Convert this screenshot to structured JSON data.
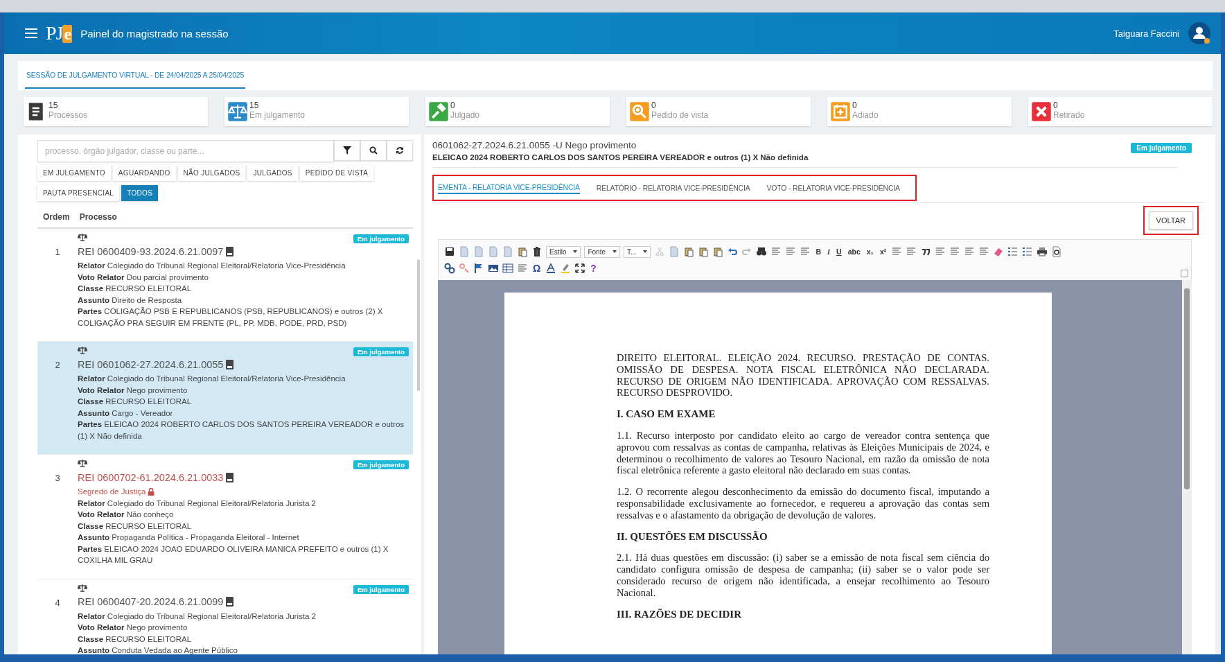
{
  "header": {
    "logo_main": "PJ",
    "logo_accent": "e",
    "title": "Painel do magistrado na sessão",
    "user": "Taiguara Faccini"
  },
  "session_tab": {
    "label": "SESSÃO DE JULGAMENTO VIRTUAL - DE 24/04/2025 A 25/04/2025",
    "selected": true
  },
  "stats": [
    {
      "count": "15",
      "label": "Processos",
      "color": "#3a3a3a"
    },
    {
      "count": "15",
      "label": "Em julgamento",
      "color": "#2e8bc9"
    },
    {
      "count": "0",
      "label": "Julgado",
      "color": "#3aa845"
    },
    {
      "count": "0",
      "label": "Pedido de vista",
      "color": "#f39c1f"
    },
    {
      "count": "0",
      "label": "Adiado",
      "color": "#f39c1f"
    },
    {
      "count": "0",
      "label": "Retirado",
      "color": "#e8303a"
    }
  ],
  "search": {
    "placeholder": "processo, órgão julgador, classe ou parte..."
  },
  "filters": [
    {
      "label": "EM JULGAMENTO",
      "selected": false
    },
    {
      "label": "AGUARDANDO",
      "selected": false
    },
    {
      "label": "NÃO JULGADOS",
      "selected": false
    },
    {
      "label": "JULGADOS",
      "selected": false
    },
    {
      "label": "PEDIDO DE VISTA",
      "selected": false
    },
    {
      "label": "PAUTA PRESENCIAL",
      "selected": false
    },
    {
      "label": "TODOS",
      "selected": true
    }
  ],
  "list_columns": [
    "Ordem",
    "Processo"
  ],
  "processes": [
    {
      "order": "1",
      "number": "REI 0600409-93.2024.6.21.0097",
      "badge": "Em julgamento",
      "selected": false,
      "secret": false,
      "fields": [
        "**Relator** Colegiado do Tribunal Regional Eleitoral/Relatoria Vice-Presidência",
        "**Voto Relator** Dou parcial provimento",
        "**Classe** RECURSO ELEITORAL",
        "**Assunto** Direito de Resposta",
        "**Partes** COLIGAÇÃO PSB E REPUBLICANOS (PSB, REPUBLICANOS) e outros (2) X COLIGAÇÃO PRA SEGUIR EM FRENTE (PL, PP, MDB, PODE, PRD, PSD)"
      ]
    },
    {
      "order": "2",
      "number": "REI 0601062-27.2024.6.21.0055",
      "badge": "Em julgamento",
      "selected": true,
      "secret": false,
      "fields": [
        "**Relator** Colegiado do Tribunal Regional Eleitoral/Relatoria Vice-Presidência",
        "**Voto Relator** Nego provimento",
        "**Classe** RECURSO ELEITORAL",
        "**Assunto** Cargo - Vereador",
        "**Partes** ELEICAO 2024 ROBERTO CARLOS DOS SANTOS PEREIRA VEREADOR e outros (1) X Não definida"
      ]
    },
    {
      "order": "3",
      "number": "REI 0600702-61.2024.6.21.0033",
      "badge": "Em julgamento",
      "selected": false,
      "secret": true,
      "secret_label": "Segredo de Justiça",
      "fields": [
        "**Relator** Colegiado do Tribunal Regional Eleitoral/Relatoria Jurista 2",
        "**Voto Relator** Não conheço",
        "**Classe** RECURSO ELEITORAL",
        "**Assunto** Propaganda Política - Propaganda Eleitoral - Internet",
        "**Partes** ELEICAO 2024 JOAO EDUARDO OLIVEIRA MANICA PREFEITO e outros (1) X COXILHA MIL GRAU"
      ]
    },
    {
      "order": "4",
      "number": "REI 0600407-20.2024.6.21.0099",
      "badge": "Em julgamento",
      "selected": false,
      "secret": false,
      "fields": [
        "**Relator** Colegiado do Tribunal Regional Eleitoral/Relatoria Jurista 2",
        "**Voto Relator** Nego provimento",
        "**Classe** RECURSO ELEITORAL",
        "**Assunto** Conduta Vedada ao Agente Público"
      ]
    }
  ],
  "detail": {
    "line1": "0601062-27.2024.6.21.0055 -U Nego provimento",
    "line2": "ELEICAO 2024 ROBERTO CARLOS DOS SANTOS PEREIRA VEREADOR e outros (1) X Não definida",
    "badge": "Em julgamento",
    "tabs": [
      {
        "label": "EMENTA - RELATORIA VICE-PRESIDÊNCIA",
        "selected": true
      },
      {
        "label": "RELATÓRIO - RELATORIA VICE-PRESIDÊNCIA",
        "selected": false
      },
      {
        "label": "VOTO - RELATORIA VICE-PRESIDÊNCIA",
        "selected": false
      }
    ],
    "back_button": "VOLTAR"
  },
  "toolbar": {
    "selects": [
      "Estilo",
      "Fonte",
      "T..."
    ],
    "text_buttons": [
      "B",
      "I",
      "U",
      "abc",
      "x₁",
      "x²",
      "Ω",
      "?"
    ]
  },
  "document": [
    {
      "kind": "paragraph",
      "text": "DIREITO ELEITORAL. ELEIÇÃO 2024. RECURSO. PRESTAÇÃO DE CONTAS. OMISSÃO DE DESPESA. NOTA FISCAL ELETRÔNICA NÃO DECLARADA. RECURSO DE ORIGEM NÃO IDENTIFICADA. APROVAÇÃO COM RESSALVAS. RECURSO DESPROVIDO."
    },
    {
      "kind": "heading",
      "text": "I. CASO EM EXAME"
    },
    {
      "kind": "paragraph",
      "text": "1.1. Recurso interposto por candidato eleito ao cargo de vereador contra sentença que aprovou com ressalvas as contas de campanha, relativas às Eleições Municipais de 2024, e determinou o recolhimento de valores ao Tesouro Nacional, em razão da omissão de nota fiscal eletrônica referente a gasto eleitoral não declarado em suas contas."
    },
    {
      "kind": "paragraph",
      "text": "1.2. O recorrente alegou desconhecimento da emissão do documento fiscal, imputando a responsabilidade exclusivamente ao fornecedor, e requereu a aprovação das contas sem ressalvas e o afastamento da obrigação de devolução de valores."
    },
    {
      "kind": "heading",
      "text": "II. QUESTÕES EM DISCUSSÃO"
    },
    {
      "kind": "paragraph",
      "text": "2.1. Há duas questões em discussão: (i) saber se a emissão de nota fiscal sem ciência do candidato configura omissão de despesa de campanha; (ii) saber se o valor pode ser considerado recurso de origem não identificada, a ensejar recolhimento ao Tesouro Nacional."
    },
    {
      "kind": "heading",
      "text": "III. RAZÕES DE DECIDIR"
    }
  ]
}
